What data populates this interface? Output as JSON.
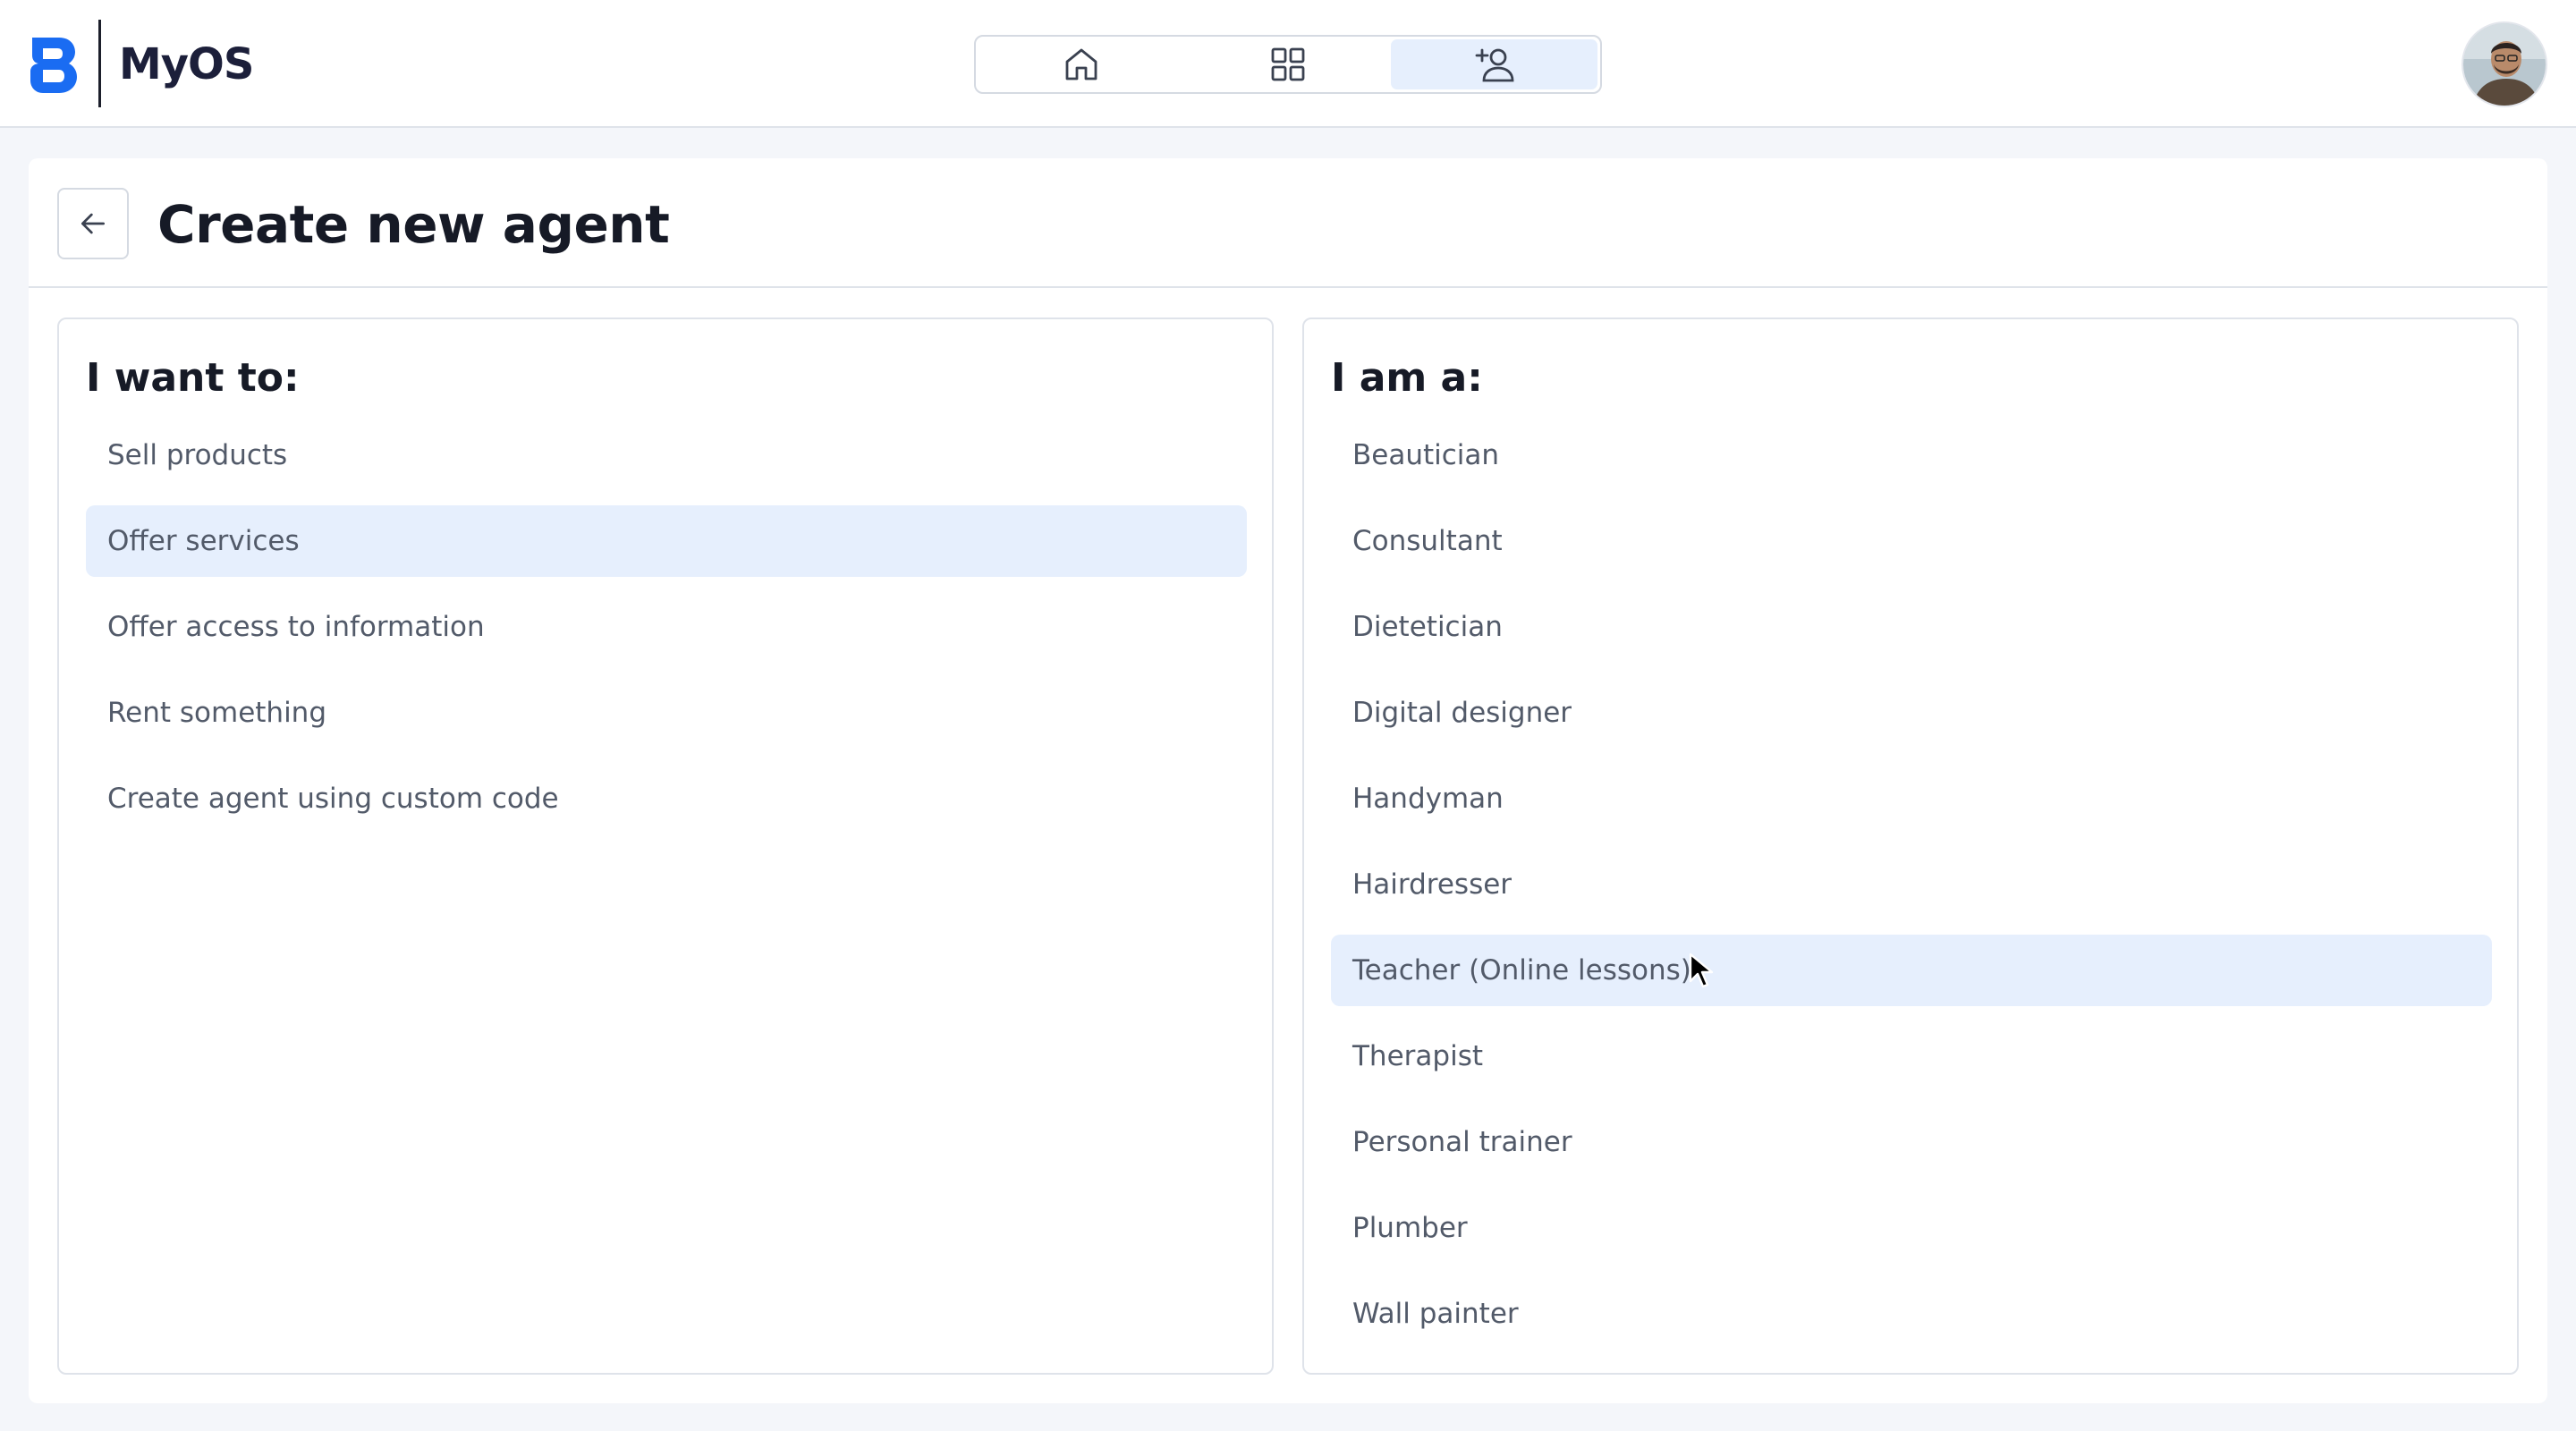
{
  "app": {
    "logo_text": "MyOS",
    "brand_color": "#1a6cf2"
  },
  "nav": {
    "items": [
      {
        "icon": "home-icon",
        "active": false
      },
      {
        "icon": "grid-icon",
        "active": false
      },
      {
        "icon": "add-user-icon",
        "active": true
      }
    ]
  },
  "page": {
    "title": "Create new agent"
  },
  "want_to": {
    "heading": "I want to:",
    "options": [
      "Sell products",
      "Offer services",
      "Offer access to information",
      "Rent something",
      "Create agent using custom code"
    ],
    "selected": "Offer services"
  },
  "i_am": {
    "heading": "I am a:",
    "options": [
      "Beautician",
      "Consultant",
      "Dietetician",
      "Digital designer",
      "Handyman",
      "Hairdresser",
      "Teacher (Online lessons)",
      "Therapist",
      "Personal trainer",
      "Plumber",
      "Wall painter"
    ],
    "selected": "Teacher (Online lessons)"
  },
  "colors": {
    "selected_bg": "#e6effd",
    "option_text": "#525a69",
    "heading_text": "#161a26"
  }
}
